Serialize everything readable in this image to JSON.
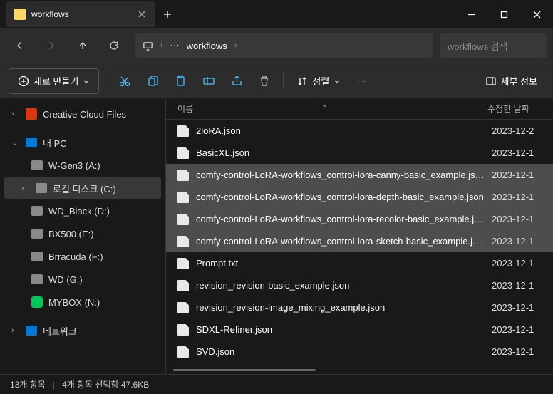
{
  "tab": {
    "title": "workflows"
  },
  "path": {
    "current": "workflows"
  },
  "search": {
    "placeholder": "workflows 검색"
  },
  "toolbar": {
    "new_label": "새로 만들기",
    "sort_label": "정렬",
    "details_label": "세부 정보"
  },
  "columns": {
    "name": "이름",
    "date": "수정한 날짜"
  },
  "sidebar": {
    "cc": "Creative Cloud Files",
    "pc": "내 PC",
    "drives": [
      {
        "label": "W-Gen3 (A:)"
      },
      {
        "label": "로컬 디스크 (C:)"
      },
      {
        "label": "WD_Black (D:)"
      },
      {
        "label": "BX500 (E:)"
      },
      {
        "label": "Brracuda (F:)"
      },
      {
        "label": "WD (G:)"
      },
      {
        "label": "MYBOX (N:)"
      }
    ],
    "network": "네트워크"
  },
  "files": [
    {
      "name": "2loRA.json",
      "date": "2023-12-2",
      "selected": false
    },
    {
      "name": "BasicXL.json",
      "date": "2023-12-1",
      "selected": false
    },
    {
      "name": "comfy-control-LoRA-workflows_control-lora-canny-basic_example.json",
      "date": "2023-12-1",
      "selected": true
    },
    {
      "name": "comfy-control-LoRA-workflows_control-lora-depth-basic_example.json",
      "date": "2023-12-1",
      "selected": true
    },
    {
      "name": "comfy-control-LoRA-workflows_control-lora-recolor-basic_example.json",
      "date": "2023-12-1",
      "selected": true
    },
    {
      "name": "comfy-control-LoRA-workflows_control-lora-sketch-basic_example.json",
      "date": "2023-12-1",
      "selected": true
    },
    {
      "name": "Prompt.txt",
      "date": "2023-12-1",
      "selected": false
    },
    {
      "name": "revision_revision-basic_example.json",
      "date": "2023-12-1",
      "selected": false
    },
    {
      "name": "revision_revision-image_mixing_example.json",
      "date": "2023-12-1",
      "selected": false
    },
    {
      "name": "SDXL-Refiner.json",
      "date": "2023-12-1",
      "selected": false
    },
    {
      "name": "SVD.json",
      "date": "2023-12-1",
      "selected": false
    }
  ],
  "status": {
    "total": "13개 항목",
    "selected": "4개 항목 선택함 47.6KB"
  }
}
